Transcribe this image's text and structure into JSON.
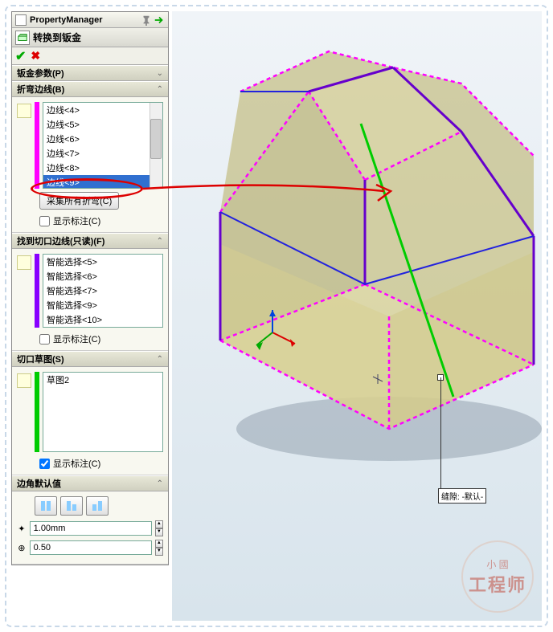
{
  "pm": {
    "title": "PropertyManager"
  },
  "feature": {
    "title": "转换到钣金"
  },
  "sections": {
    "sheet_params": {
      "title": "钣金参数(P)"
    },
    "bend_edges": {
      "title": "折弯边线(B)",
      "items": [
        "边线<4>",
        "边线<5>",
        "边线<6>",
        "边线<7>",
        "边线<8>",
        "边线<9>"
      ],
      "selected_index": 5,
      "collect_btn": "采集所有折弯(C)",
      "show_callout": "显示标注(C)"
    },
    "rip_edges": {
      "title": "找到切口边线(只读)(F)",
      "items": [
        "智能选择<5>",
        "智能选择<6>",
        "智能选择<7>",
        "智能选择<9>",
        "智能选择<10>"
      ],
      "show_callout": "显示标注(C)"
    },
    "rip_sketch": {
      "title": "切口草图(S)",
      "items": [
        "草图2"
      ],
      "show_callout": "显示标注(C)"
    },
    "corner_defaults": {
      "title": "边角默认值",
      "gap": "1.00mm",
      "ratio": "0.50"
    }
  },
  "callout": {
    "label": "缝隙:",
    "value": "-默认-"
  },
  "watermark": {
    "top": "小 國",
    "main": "工程师"
  }
}
